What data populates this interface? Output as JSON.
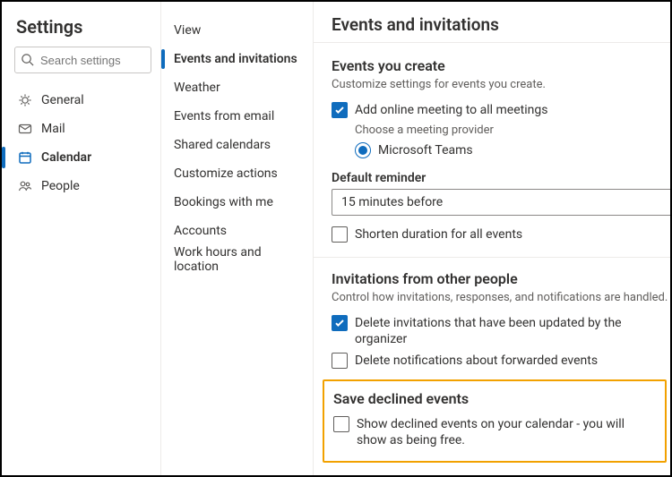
{
  "settings_title": "Settings",
  "search": {
    "placeholder": "Search settings"
  },
  "left_nav": {
    "general": "General",
    "mail": "Mail",
    "calendar": "Calendar",
    "people": "People"
  },
  "sub_nav": {
    "view": "View",
    "events_invitations": "Events and invitations",
    "weather": "Weather",
    "events_from_email": "Events from email",
    "shared_calendars": "Shared calendars",
    "customize_actions": "Customize actions",
    "bookings_with_me": "Bookings with me",
    "accounts": "Accounts",
    "work_hours": "Work hours and location"
  },
  "main": {
    "title": "Events and invitations",
    "events_you_create": {
      "heading": "Events you create",
      "sub": "Customize settings for events you create.",
      "add_online": "Add online meeting to all meetings",
      "choose_provider": "Choose a meeting provider",
      "provider_teams": "Microsoft Teams",
      "default_reminder_label": "Default reminder",
      "default_reminder_value": "15 minutes before",
      "shorten": "Shorten duration for all events"
    },
    "invitations": {
      "heading": "Invitations from other people",
      "sub": "Control how invitations, responses, and notifications are handled.",
      "delete_updated": "Delete invitations that have been updated by the organizer",
      "delete_forwarded": "Delete notifications about forwarded events"
    },
    "save_declined": {
      "heading": "Save declined events",
      "show_declined": "Show declined events on your calendar - you will show as being free."
    }
  }
}
